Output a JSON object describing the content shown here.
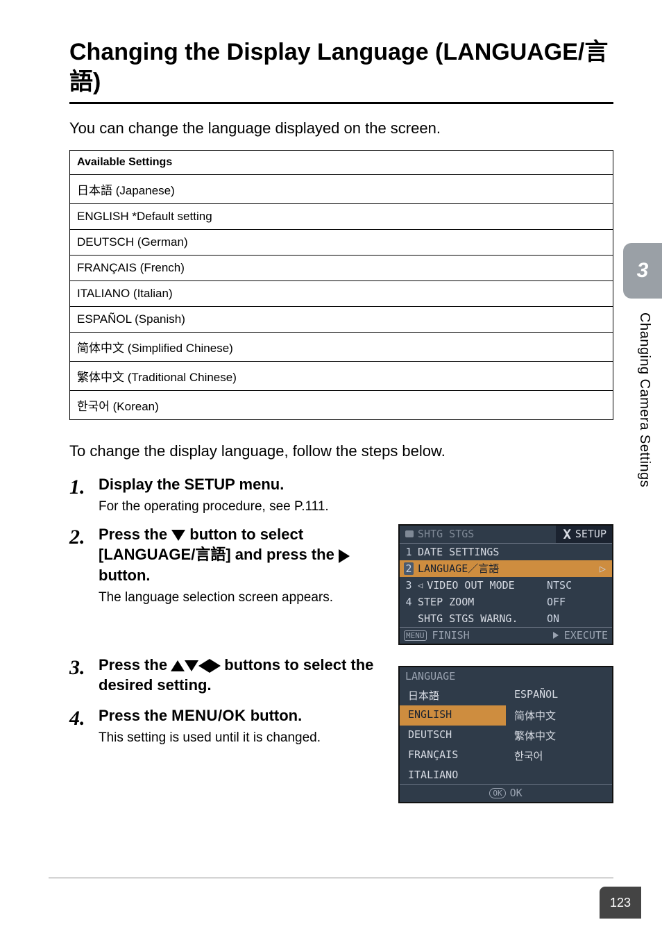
{
  "title": "Changing the Display Language (LANGUAGE/言語)",
  "lead": "You can change the language displayed on the screen.",
  "settings_header": "Available Settings",
  "settings": [
    "日本語 (Japanese)",
    "ENGLISH *Default setting",
    "DEUTSCH (German)",
    "FRANÇAIS (French)",
    "ITALIANO (Italian)",
    "ESPAÑOL (Spanish)",
    "简体中文 (Simplified Chinese)",
    "繁体中文 (Traditional Chinese)",
    "한국어 (Korean)"
  ],
  "body_text": "To change the display language, follow the steps below.",
  "steps": {
    "s1": {
      "num": "1.",
      "title": "Display the SETUP menu.",
      "sub": "For the operating procedure, see P.111."
    },
    "s2": {
      "num": "2.",
      "title_a": "Press the ",
      "title_b": " button to select [LANGUAGE/言語] and press the ",
      "title_c": " button.",
      "sub": "The language selection screen appears."
    },
    "s3": {
      "num": "3.",
      "title_a": "Press the ",
      "title_b": " buttons to select the desired setting."
    },
    "s4": {
      "num": "4.",
      "title_a": "Press the ",
      "menu_ok": "MENU/OK",
      "title_b": " button.",
      "sub": "This setting is used until it is changed."
    }
  },
  "lcd1": {
    "tab_left": "SHTG STGS",
    "tab_right": "SETUP",
    "rows": [
      {
        "idx": "1",
        "label": "DATE SETTINGS",
        "val": "",
        "sel": false,
        "left_arrow": false,
        "right_arrow": false
      },
      {
        "idx": "2",
        "label": "LANGUAGE／言語",
        "val": "",
        "sel": true,
        "left_arrow": false,
        "right_arrow": true
      },
      {
        "idx": "3",
        "label": "VIDEO OUT MODE",
        "val": "NTSC",
        "sel": false,
        "left_arrow": true,
        "right_arrow": false
      },
      {
        "idx": "4",
        "label": "STEP ZOOM",
        "val": "OFF",
        "sel": false,
        "left_arrow": false,
        "right_arrow": false
      },
      {
        "idx": "",
        "label": "SHTG STGS WARNG.",
        "val": "ON",
        "sel": false,
        "left_arrow": false,
        "right_arrow": false
      }
    ],
    "foot_left_button": "MENU",
    "foot_left": "FINISH",
    "foot_right": "EXECUTE"
  },
  "lcd2": {
    "head": "LANGUAGE",
    "grid": [
      {
        "text": "日本語",
        "sel": false
      },
      {
        "text": "ESPAÑOL",
        "sel": false
      },
      {
        "text": "ENGLISH",
        "sel": true
      },
      {
        "text": "简体中文",
        "sel": false
      },
      {
        "text": "DEUTSCH",
        "sel": false
      },
      {
        "text": "繁体中文",
        "sel": false
      },
      {
        "text": "FRANÇAIS",
        "sel": false
      },
      {
        "text": "한국어",
        "sel": false
      },
      {
        "text": "ITALIANO",
        "sel": false
      },
      {
        "text": "",
        "sel": false
      }
    ],
    "ok_button": "OK",
    "ok_label": "OK"
  },
  "side": {
    "chapter": "3",
    "label": "Changing Camera Settings"
  },
  "page_number": "123"
}
